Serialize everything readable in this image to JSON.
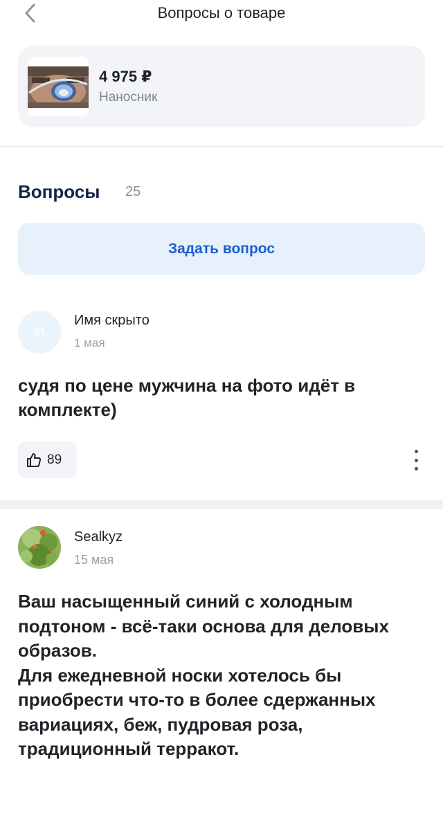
{
  "header": {
    "title": "Вопросы о товаре",
    "back_icon": "chevron-left-icon"
  },
  "product": {
    "price": "4 975 ₽",
    "name": "Наносник",
    "thumb": "product-photo"
  },
  "questions_section": {
    "title": "Вопросы",
    "count": "25",
    "ask_button": "Задать вопрос"
  },
  "questions": [
    {
      "avatar_letter": "И",
      "author": "Имя скрыто",
      "date": "1 мая",
      "text": "судя по цене мужчина на фото идёт в комплекте)",
      "likes": "89",
      "like_icon": "thumbs-up-icon",
      "menu_icon": "more-vertical-icon"
    },
    {
      "avatar": "user-avatar-photo",
      "author": "Sealkyz",
      "date": "15 мая",
      "text": "Ваш насыщенный синий с холодным подтоном - всё-таки основа для деловых образов.\nДля ежедневной носки хотелось бы приобрести что-то в более сдержанных вариациях, беж, пудровая роза, традиционный терракот."
    }
  ],
  "colors": {
    "accent": "#1a5fd1",
    "button_bg": "#e6f1fb",
    "card_bg": "#f2f4f7",
    "title": "#0f2747",
    "muted": "#9aa1a9"
  }
}
